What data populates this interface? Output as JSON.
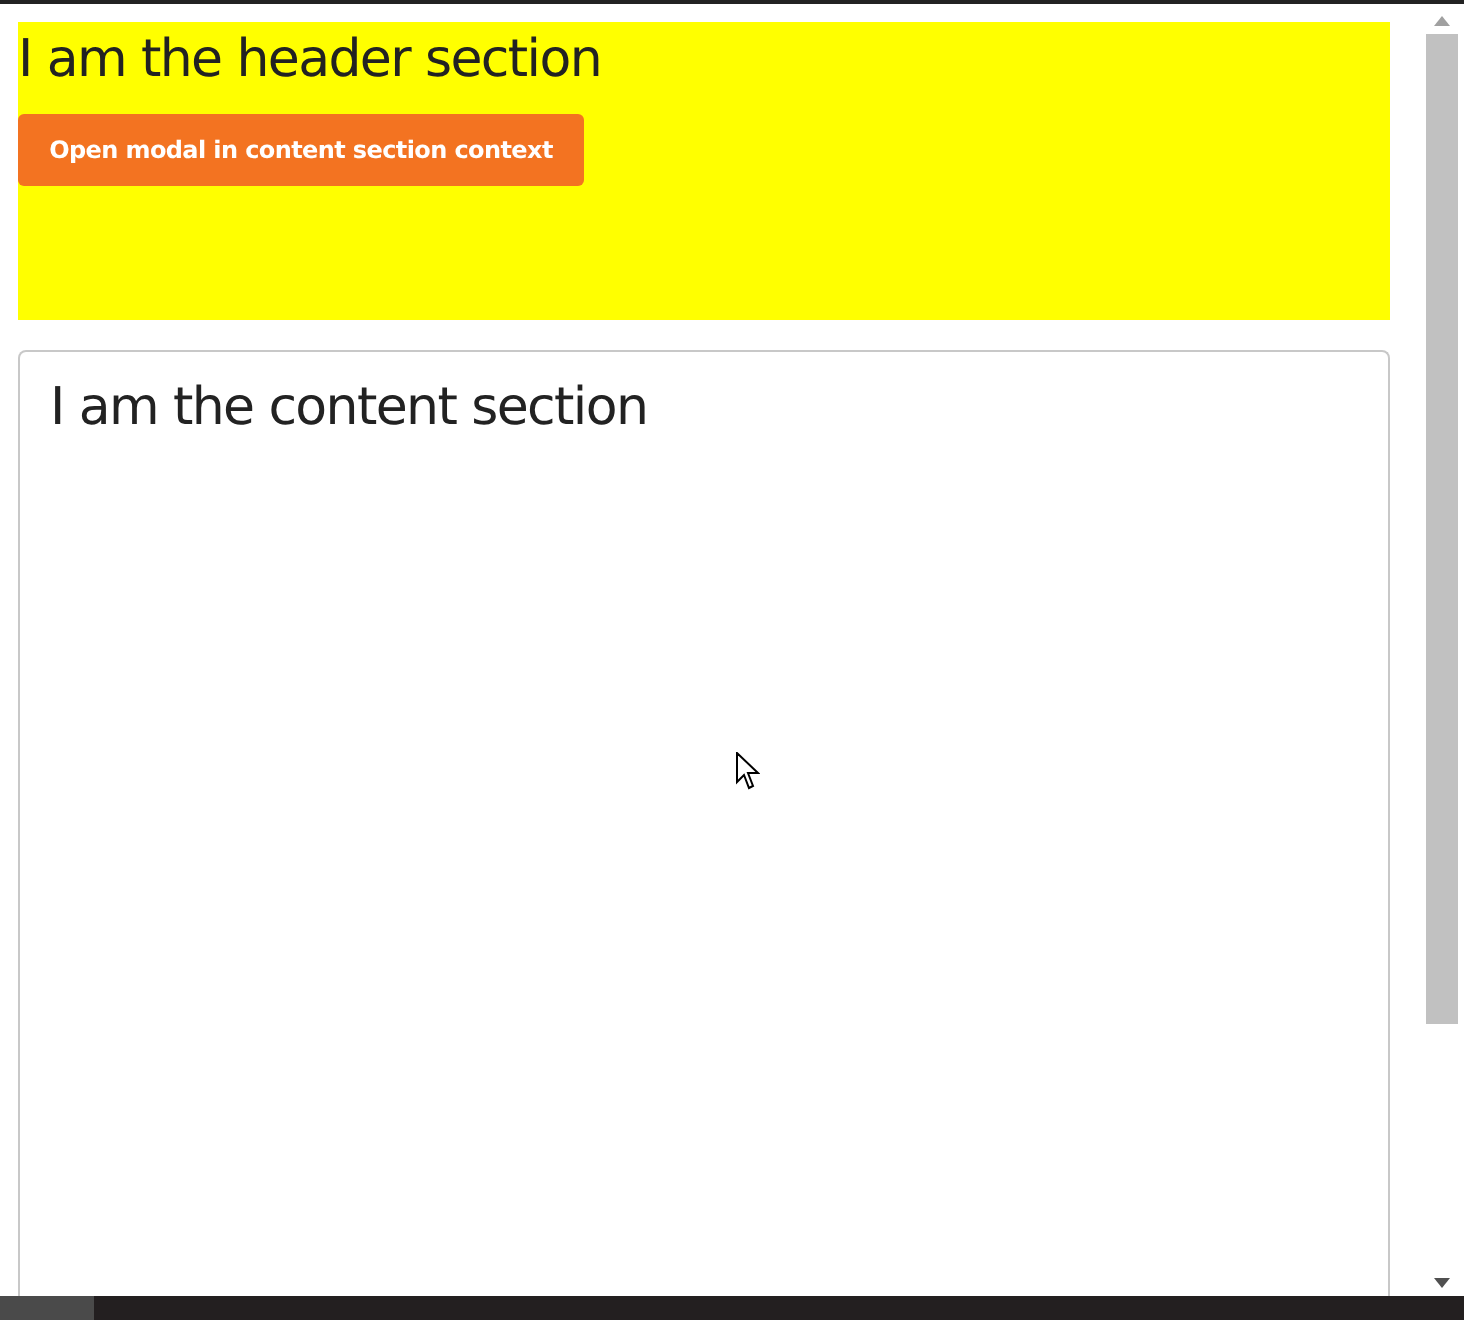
{
  "header": {
    "title": "I am the header section",
    "button": "Open modal in content section context"
  },
  "content": {
    "title": "I am the content section"
  }
}
